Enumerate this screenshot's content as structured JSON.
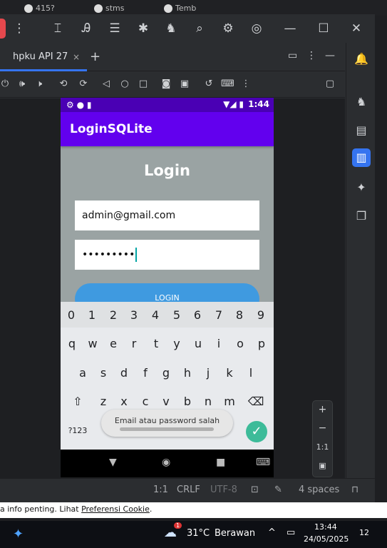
{
  "browser": {
    "tabs": [
      {
        "label": "415?"
      },
      {
        "label": "stms"
      },
      {
        "label": "Temb"
      }
    ]
  },
  "ide": {
    "device_tab": {
      "label": "hpku API 27",
      "close": "×",
      "add": "+"
    },
    "statusbar": {
      "pos": "1:1",
      "line_ending": "CRLF",
      "encoding": "UTF-8",
      "indent": "4 spaces"
    },
    "zoom": {
      "in": "+",
      "out": "−",
      "reset": "1:1"
    }
  },
  "phone": {
    "status": {
      "time": "1:44"
    },
    "app_title": "LoginSQLite",
    "heading": "Login",
    "email_value": "admin@gmail.com",
    "password_mask": "•••••••••",
    "login_button": "LOGIN",
    "keyboard": {
      "numbers": [
        "1",
        "2",
        "3",
        "4",
        "5",
        "6",
        "7",
        "8",
        "9",
        "0"
      ],
      "row1": [
        "q",
        "w",
        "e",
        "r",
        "t",
        "y",
        "u",
        "i",
        "o",
        "p"
      ],
      "row2": [
        "a",
        "s",
        "d",
        "f",
        "g",
        "h",
        "j",
        "k",
        "l"
      ],
      "row3": [
        "z",
        "x",
        "c",
        "v",
        "b",
        "n",
        "m"
      ],
      "sym_key": "?123"
    },
    "toast": "Email atau password salah"
  },
  "cookie_banner": {
    "text": "a info penting. Lihat ",
    "link": "Preferensi Cookie",
    "end": "."
  },
  "taskbar": {
    "temp": "31°C",
    "weather": "Berawan",
    "time": "13:44",
    "date": "24/05/2025",
    "notif_count": "12",
    "badge": "1"
  }
}
